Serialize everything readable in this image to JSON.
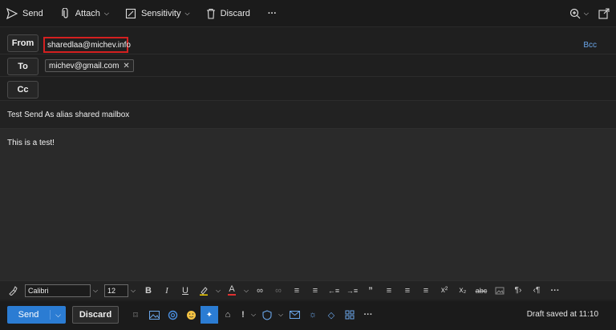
{
  "toolbar": {
    "send_label": "Send",
    "attach_label": "Attach",
    "sensitivity_label": "Sensitivity",
    "discard_label": "Discard",
    "more_label": "···"
  },
  "header": {
    "from_label": "From",
    "from_value": "sharedlaa@michev.info",
    "bcc_label": "Bcc",
    "to_label": "To",
    "to_recipient": "michev@gmail.com",
    "cc_label": "Cc"
  },
  "subject": "Test Send As alias shared mailbox",
  "body_text": "This is a test!",
  "format": {
    "font": "Calibri",
    "size": "12"
  },
  "bottom": {
    "send_label": "Send",
    "discard_label": "Discard",
    "draft_status": "Draft saved at 11:10"
  },
  "colors": {
    "accent": "#2b7cd3",
    "highlight_red": "#d42020",
    "background": "#1f1f1f"
  }
}
